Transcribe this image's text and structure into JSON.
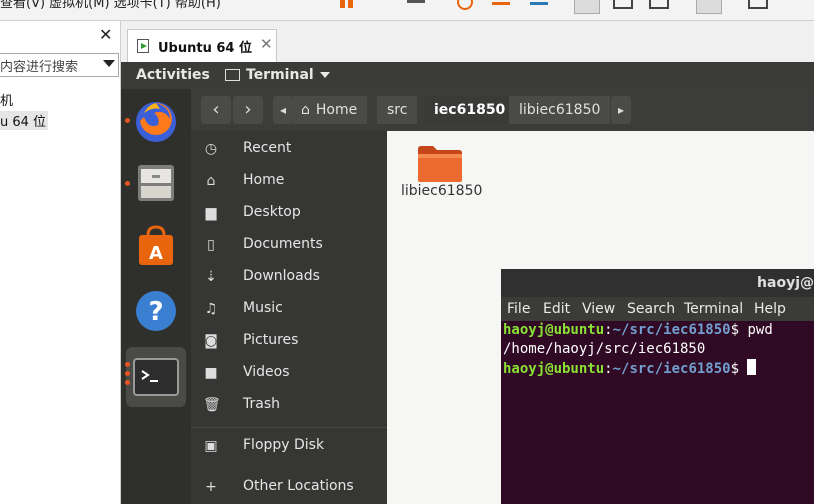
{
  "host": {
    "menu_text": "查看(V)   虚拟机(M)   选项卡(T)   帮助(H)",
    "library": {
      "search_placeholder": "在此处键入内容进行搜索",
      "search_visible": "内容进行搜索",
      "item1": "机",
      "item2": "u 64 位"
    },
    "tab": {
      "label": "Ubuntu 64 位"
    }
  },
  "ubuntu": {
    "topbar": {
      "activities": "Activities",
      "app_menu": "Terminal"
    },
    "breadcrumb": [
      "Home",
      "src",
      "iec61850",
      "libiec61850"
    ],
    "sidebar": [
      {
        "label": "Recent",
        "icon": "clock-icon"
      },
      {
        "label": "Home",
        "icon": "home-icon"
      },
      {
        "label": "Desktop",
        "icon": "folder-icon"
      },
      {
        "label": "Documents",
        "icon": "document-icon"
      },
      {
        "label": "Downloads",
        "icon": "download-icon"
      },
      {
        "label": "Music",
        "icon": "music-icon"
      },
      {
        "label": "Pictures",
        "icon": "camera-icon"
      },
      {
        "label": "Videos",
        "icon": "video-icon"
      },
      {
        "label": "Trash",
        "icon": "trash-icon"
      },
      {
        "label": "Floppy Disk",
        "icon": "floppy-icon"
      },
      {
        "label": "Other Locations",
        "icon": "plus-icon"
      }
    ],
    "files": [
      {
        "name": "libiec61850"
      }
    ],
    "terminal": {
      "title": "haoyj@",
      "menu": [
        "File",
        "Edit",
        "View",
        "Search",
        "Terminal",
        "Help"
      ],
      "user_host": "haoyj@ubuntu",
      "path": "~/src/iec61850",
      "lines": [
        {
          "cmd": " pwd"
        },
        {
          "output": "/home/haoyj/src/iec61850"
        },
        {
          "cmd": " "
        }
      ]
    }
  },
  "colors": {
    "ubuntu_orange": "#e95420",
    "terminal_bg": "#300a24",
    "prompt_user": "#8ae234",
    "prompt_path": "#729fcf"
  }
}
